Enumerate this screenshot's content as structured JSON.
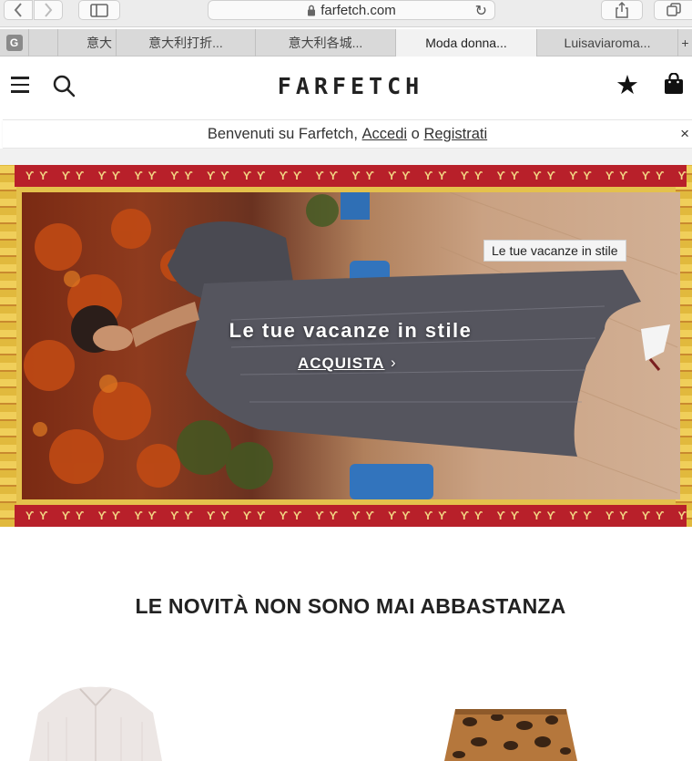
{
  "browser": {
    "url": "farfetch.com",
    "tabs": [
      {
        "label": "意大"
      },
      {
        "label": "意大利打折..."
      },
      {
        "label": "意大利各城..."
      },
      {
        "label": "Moda donna..."
      },
      {
        "label": "Luisaviaroma..."
      }
    ],
    "favicon_letter": "G",
    "new_tab": "+"
  },
  "header": {
    "logo": "FARFETCH",
    "icons": [
      "menu-icon",
      "search-icon",
      "star-icon",
      "shopping-bag-icon"
    ]
  },
  "welcome": {
    "prefix": "Benvenuti su Farfetch, ",
    "login": "Accedi",
    "connector": " o ",
    "register": "Registrati",
    "close": "×"
  },
  "hero": {
    "tooltip": "Le tue vacanze in stile",
    "title": "Le tue vacanze in stile",
    "cta": "ACQUISTA",
    "cta_arrow": "›",
    "motif": "ϒϒ ϒϒ ϒϒ ϒϒ ϒϒ ϒϒ ϒϒ ϒϒ ϒϒ ϒϒ ϒϒ ϒϒ ϒϒ ϒϒ ϒϒ ϒϒ ϒϒ ϒϒ ϒϒ ϒϒ ϒϒ ϒϒ ϒϒ ϒϒ ϒϒ ϒϒ"
  },
  "new_in": {
    "title": "LE NOVITÀ NON SONO MAI ABBASTANZA"
  },
  "colors": {
    "brand": "#222222",
    "band_red": "#b8202a",
    "pattern_gold": "#e1b93d"
  }
}
